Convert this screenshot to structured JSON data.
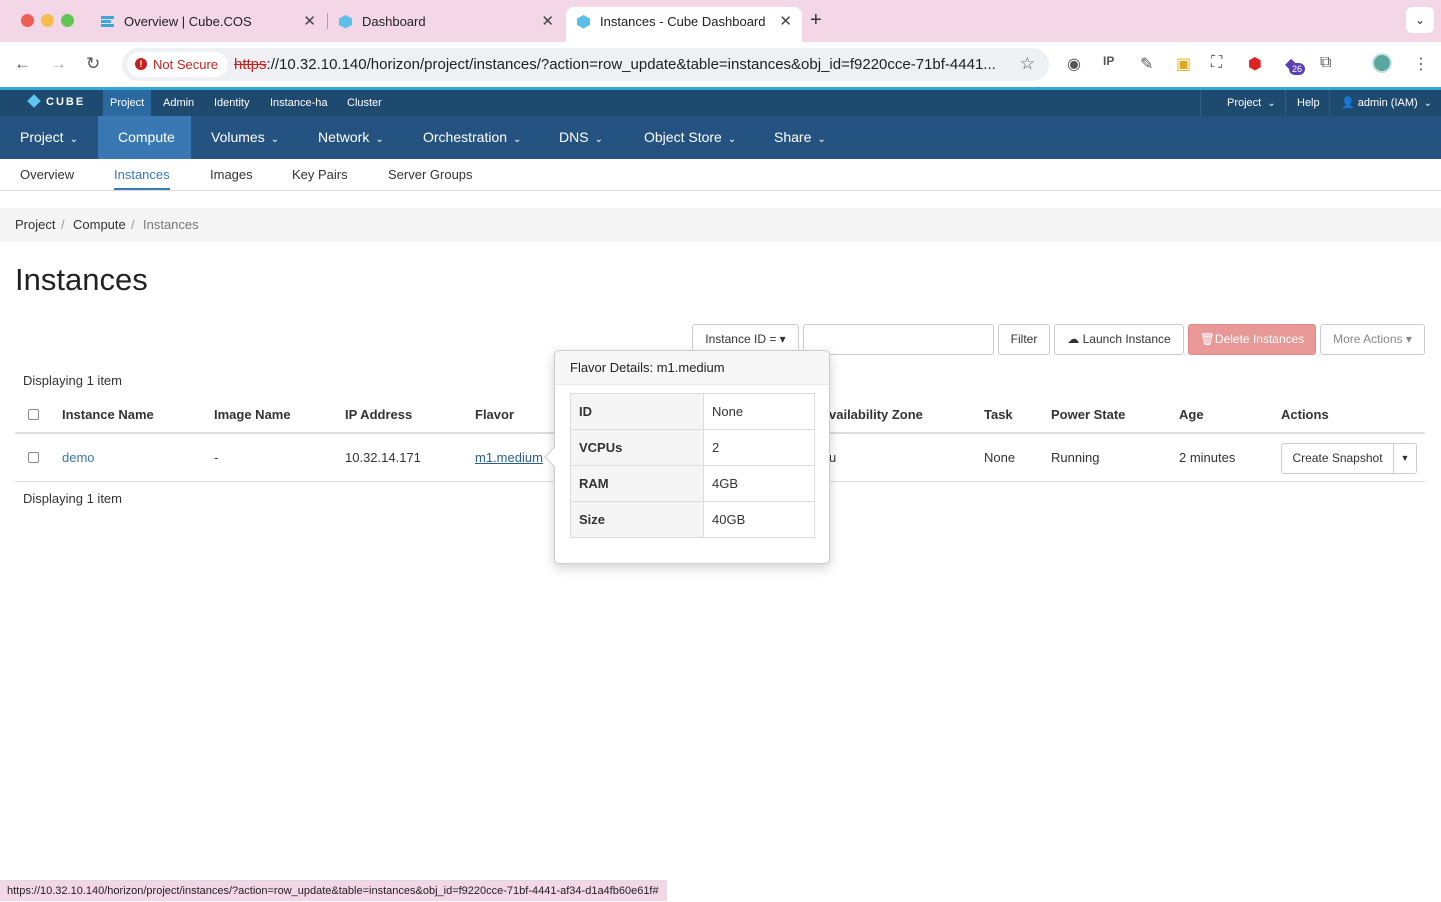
{
  "browser": {
    "tabs": [
      {
        "title": "Overview | Cube.COS",
        "active": false
      },
      {
        "title": "Dashboard",
        "active": false
      },
      {
        "title": "Instances - Cube Dashboard",
        "active": true
      }
    ],
    "not_secure_label": "Not Secure",
    "url_proto": "https",
    "url_rest": "://10.32.10.140/horizon/project/instances/?action=row_update&table=instances&obj_id=f9220cce-71bf-4441...",
    "extension_badge": "26",
    "status_url": "https://10.32.10.140/horizon/project/instances/?action=row_update&table=instances&obj_id=f9220cce-71bf-4441-af34-d1a4fb60e61f#"
  },
  "app": {
    "logo": "CUBE",
    "top_nav": [
      "Project",
      "Admin",
      "Identity",
      "Instance-ha",
      "Cluster"
    ],
    "top_right": {
      "project": "Project",
      "help": "Help",
      "user": "admin (IAM)"
    },
    "main_nav": [
      "Project",
      "Compute",
      "Volumes",
      "Network",
      "Orchestration",
      "DNS",
      "Object Store",
      "Share"
    ],
    "sub_nav": [
      "Overview",
      "Instances",
      "Images",
      "Key Pairs",
      "Server Groups"
    ],
    "breadcrumb": [
      "Project",
      "Compute",
      "Instances"
    ],
    "page_title": "Instances"
  },
  "toolbar": {
    "filter_select": "Instance ID =",
    "filter_button": "Filter",
    "launch_button": "Launch Instance",
    "delete_button": "Delete Instances",
    "more_actions": "More Actions"
  },
  "table": {
    "display_count": "Displaying 1 item",
    "columns": [
      "Instance Name",
      "Image Name",
      "IP Address",
      "Flavor",
      "vailability Zone",
      "Task",
      "Power State",
      "Age",
      "Actions"
    ],
    "rows": [
      {
        "name": "demo",
        "image": "-",
        "ip": "10.32.14.171",
        "flavor": "m1.medium",
        "zone": "u",
        "task": "None",
        "power": "Running",
        "age": "2 minutes",
        "action": "Create Snapshot"
      }
    ]
  },
  "popover": {
    "title": "Flavor Details: m1.medium",
    "rows": [
      {
        "key": "ID",
        "value": "None"
      },
      {
        "key": "VCPUs",
        "value": "2"
      },
      {
        "key": "RAM",
        "value": "4GB"
      },
      {
        "key": "Size",
        "value": "40GB"
      }
    ]
  },
  "colors": {
    "brand_bar": "#1f4a70",
    "main_nav": "#245381",
    "active_nav": "#3a78b4",
    "accent_line": "#33a9dc",
    "danger": "#e89896"
  }
}
